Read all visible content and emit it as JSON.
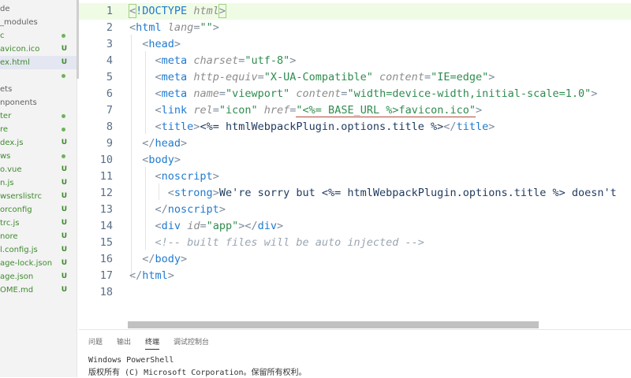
{
  "sidebar": {
    "items": [
      {
        "label": "de",
        "status": "",
        "color": "gray"
      },
      {
        "label": "_modules",
        "status": "",
        "color": "gray"
      },
      {
        "label": "c",
        "status": "dot",
        "color": "green"
      },
      {
        "label": "avicon.ico",
        "status": "U",
        "color": "green"
      },
      {
        "label": "ex.html",
        "status": "U",
        "color": "green",
        "selected": true
      },
      {
        "label": "",
        "status": "dot",
        "color": "green"
      },
      {
        "label": "",
        "status": "",
        "color": "gray"
      },
      {
        "label": "ets",
        "status": "",
        "color": "gray"
      },
      {
        "label": "nponents",
        "status": "",
        "color": "gray"
      },
      {
        "label": "ter",
        "status": "dot",
        "color": "green"
      },
      {
        "label": "re",
        "status": "dot",
        "color": "green"
      },
      {
        "label": "dex.js",
        "status": "U",
        "color": "green"
      },
      {
        "label": "ws",
        "status": "dot",
        "color": "green"
      },
      {
        "label": "o.vue",
        "status": "U",
        "color": "green"
      },
      {
        "label": "n.js",
        "status": "U",
        "color": "green"
      },
      {
        "label": "wserslistrc",
        "status": "U",
        "color": "green"
      },
      {
        "label": "orconfig",
        "status": "U",
        "color": "green"
      },
      {
        "label": "trc.js",
        "status": "U",
        "color": "green"
      },
      {
        "label": "nore",
        "status": "U",
        "color": "green"
      },
      {
        "label": "l.config.js",
        "status": "U",
        "color": "green"
      },
      {
        "label": "age-lock.json",
        "status": "U",
        "color": "green"
      },
      {
        "label": "age.json",
        "status": "U",
        "color": "green"
      },
      {
        "label": "OME.md",
        "status": "U",
        "color": "green"
      }
    ]
  },
  "editor": {
    "line_numbers": [
      "1",
      "2",
      "3",
      "4",
      "5",
      "6",
      "7",
      "8",
      "9",
      "10",
      "11",
      "12",
      "13",
      "14",
      "15",
      "16",
      "17",
      "18"
    ],
    "active_line": 1
  },
  "panel": {
    "tabs": [
      "问题",
      "输出",
      "终端",
      "调试控制台"
    ],
    "active_tab": "终端",
    "terminal_lines": [
      "Windows PowerShell",
      "版权所有 (C) Microsoft Corporation。保留所有权利。"
    ]
  },
  "colors": {
    "tag": "#1f7ad1",
    "attribute": "#8c8c8c",
    "string": "#2f8c4f",
    "comment": "#9aa6b2",
    "active_line_bg": "#f0fbe5",
    "git_untracked": "#3f8a2f"
  }
}
